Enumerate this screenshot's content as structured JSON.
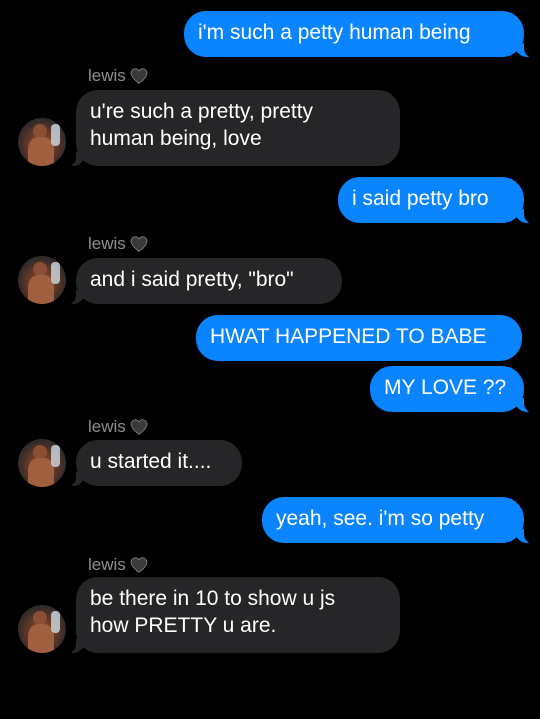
{
  "contact": {
    "name": "lewis"
  },
  "colors": {
    "sent": "#0a84ff",
    "received": "#262628",
    "background": "#000000"
  },
  "messages": [
    {
      "from": "me",
      "text": "i'm such a petty human being"
    },
    {
      "from": "lewis",
      "lines": [
        "u're such a pretty, pretty",
        "human being, love"
      ]
    },
    {
      "from": "me",
      "text": "i said petty bro"
    },
    {
      "from": "lewis",
      "text": "and i said pretty, \"bro\""
    },
    {
      "from": "me",
      "text": "HWAT HAPPENED TO BABE"
    },
    {
      "from": "me",
      "text": "MY LOVE ??"
    },
    {
      "from": "lewis",
      "text": "u started it...."
    },
    {
      "from": "me",
      "text": "yeah, see. i'm so petty"
    },
    {
      "from": "lewis",
      "lines": [
        "be there in 10 to show u js",
        "how PRETTY u are."
      ]
    }
  ],
  "icons": {
    "name_suffix": "black-heart-icon",
    "avatar": "contact-avatar"
  }
}
